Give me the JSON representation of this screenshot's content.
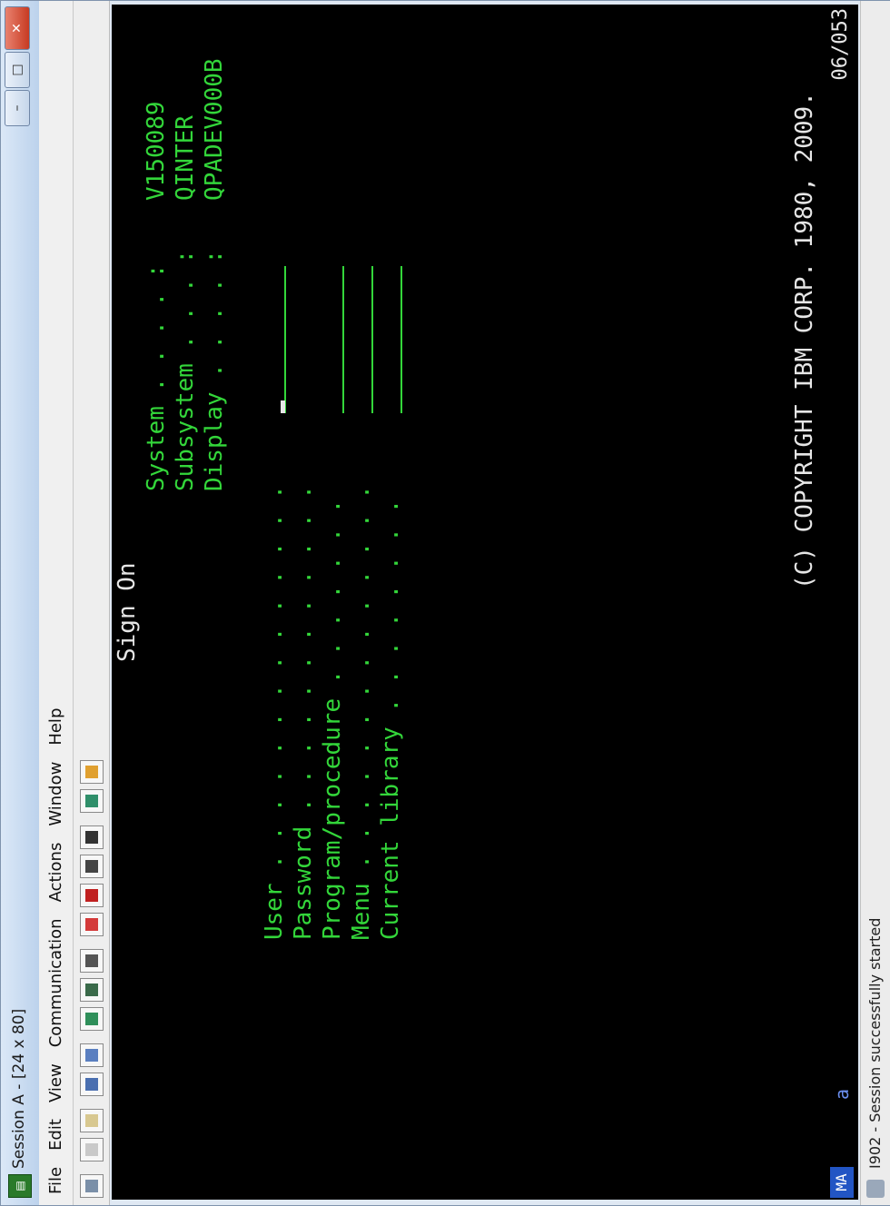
{
  "window": {
    "title": "Session A - [24 x 80]",
    "minimize": "–",
    "maximize": "□",
    "close": "✕"
  },
  "menu": [
    "File",
    "Edit",
    "View",
    "Communication",
    "Actions",
    "Window",
    "Help"
  ],
  "toolbar_icons": [
    "print-icon",
    "copy-icon",
    "paste-icon",
    "send-icon",
    "receive-icon",
    "display-icon",
    "keyboard-icon",
    "macro-icon",
    "record-icon",
    "stop-icon",
    "play-icon",
    "clipboard-icon",
    "globe-icon",
    "help-icon"
  ],
  "screen": {
    "title": "Sign On",
    "info": [
      {
        "label": "System . . . . :",
        "value": "V150089"
      },
      {
        "label": "Subsystem . . . :",
        "value": "QINTER"
      },
      {
        "label": "Display . . . . :",
        "value": "QPADEV000B"
      }
    ],
    "fields": [
      {
        "label": "User . . . . . . . . . . . . . . "
      },
      {
        "label": "Password . . . . . . . . . . . . "
      },
      {
        "label": "Program/procedure . . . . . . . "
      },
      {
        "label": "Menu . . . . . . . . . . . . . . "
      },
      {
        "label": "Current library . . . . . . . . "
      }
    ],
    "copyright": "(C) COPYRIGHT IBM CORP. 1980, 2009."
  },
  "oia": {
    "mode": "MA",
    "indicator": "a",
    "cursor_pos": "06/053"
  },
  "status": {
    "message": "I902 - Session successfully started"
  },
  "colors": {
    "terminal_bg": "#000000",
    "terminal_fg": "#33d63a",
    "accent": "#3d6fd1"
  }
}
